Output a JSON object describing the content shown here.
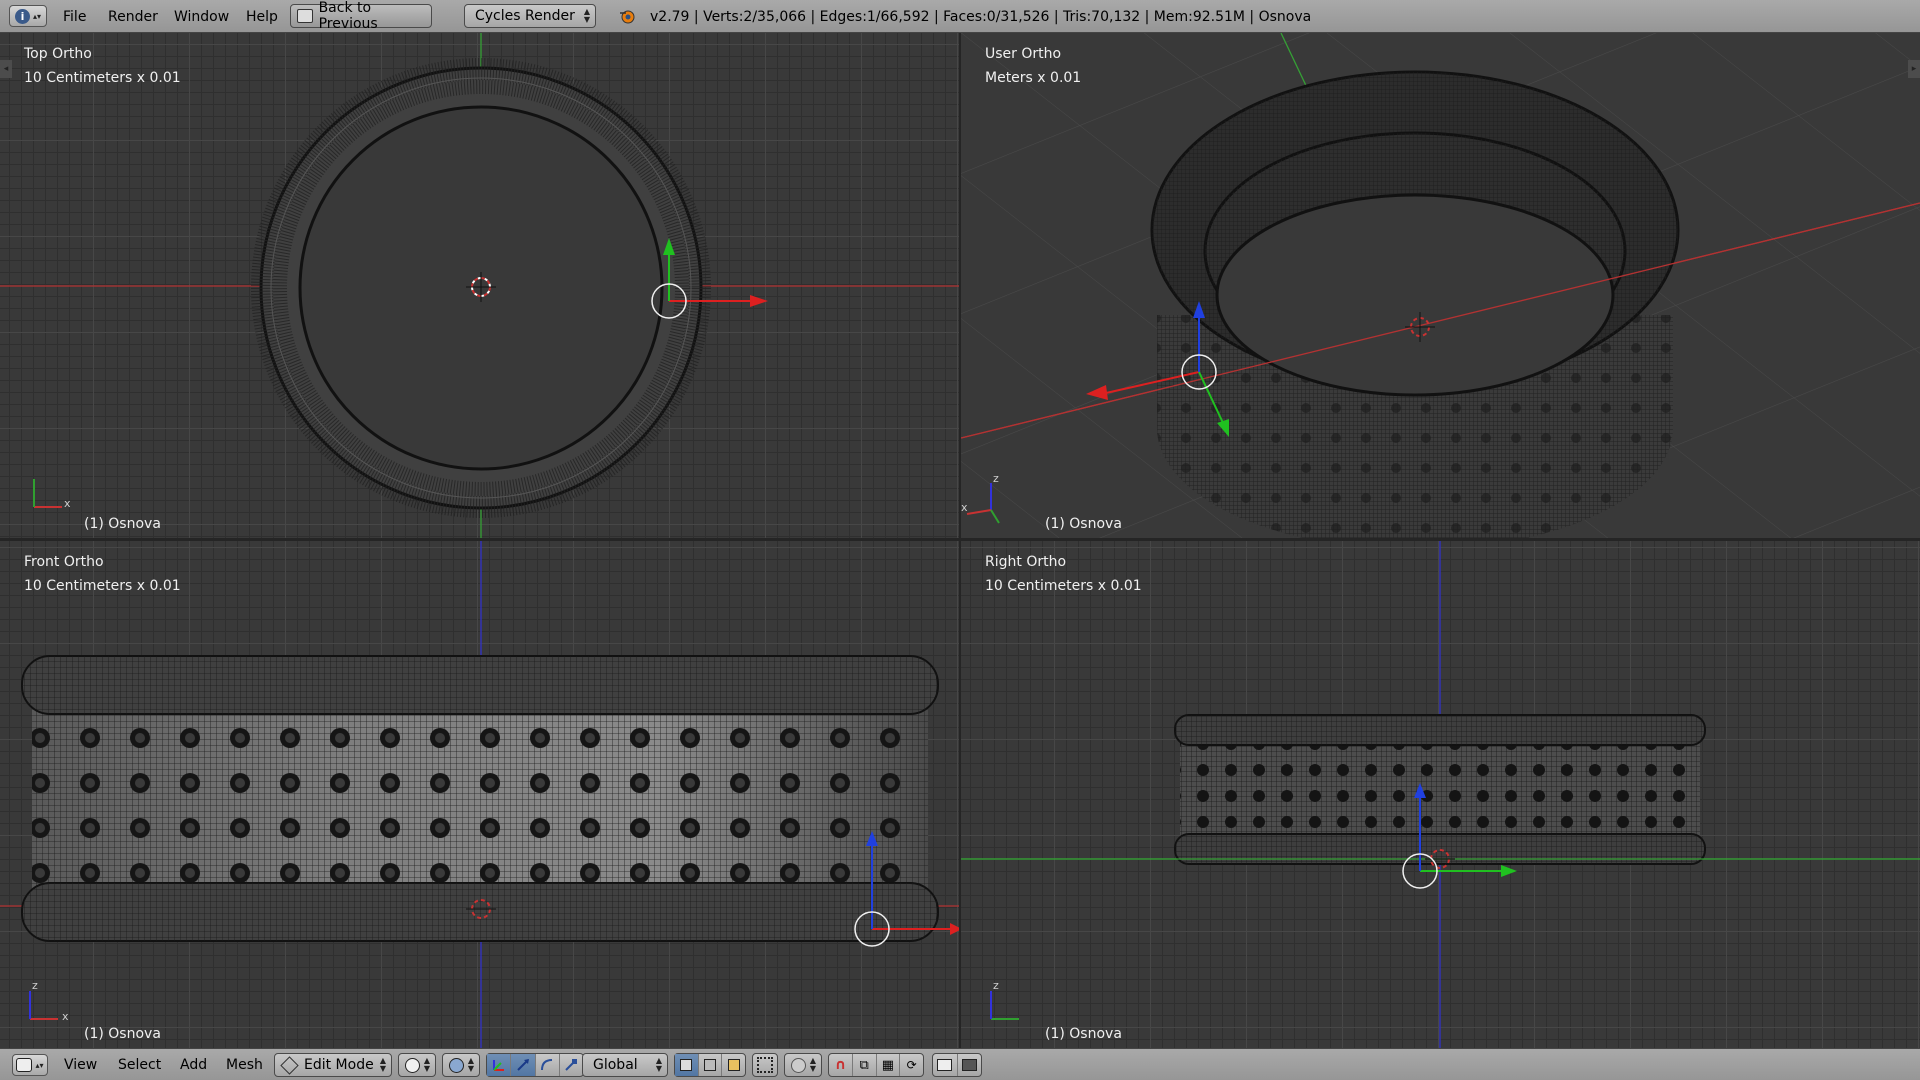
{
  "top_header": {
    "menus": [
      "File",
      "Render",
      "Window",
      "Help"
    ],
    "back_button": "Back to Previous",
    "render_engine": "Cycles Render",
    "stats": "v2.79 | Verts:2/35,066 | Edges:1/66,592 | Faces:0/31,526 | Tris:70,132 | Mem:92.51M | Osnova"
  },
  "viewports": {
    "top": {
      "title": "Top Ortho",
      "scale": "10 Centimeters x 0.01",
      "object": "(1) Osnova",
      "axis_labels": [
        "x"
      ]
    },
    "user": {
      "title": "User Ortho",
      "scale": "Meters x 0.01",
      "object": "(1) Osnova",
      "axis_labels": [
        "z",
        "x"
      ]
    },
    "front": {
      "title": "Front Ortho",
      "scale": "10 Centimeters x 0.01",
      "object": "(1) Osnova",
      "axis_labels": [
        "z",
        "x"
      ]
    },
    "right": {
      "title": "Right Ortho",
      "scale": "10 Centimeters x 0.01",
      "object": "(1) Osnova",
      "axis_labels": [
        "z"
      ]
    }
  },
  "bottom_header": {
    "menus": [
      "View",
      "Select",
      "Add",
      "Mesh"
    ],
    "mode": "Edit Mode",
    "orientation": "Global"
  },
  "colors": {
    "x_axis": "#c83232",
    "y_axis": "#32a032",
    "z_axis": "#3232dc",
    "mesh_wire": "#1a1a1a",
    "header_bg": "#a0a0a0",
    "viewport_bg": "#393939",
    "active_tool": "#5680b0"
  },
  "icons": [
    "info-icon",
    "blender-render-icon",
    "back-icon",
    "mesh-icon",
    "pivot-icon",
    "manipulator-icon",
    "vertex-select-icon",
    "edge-select-icon",
    "face-select-icon",
    "proportional-icon",
    "snap-icon",
    "render-icon",
    "camera-icon"
  ]
}
